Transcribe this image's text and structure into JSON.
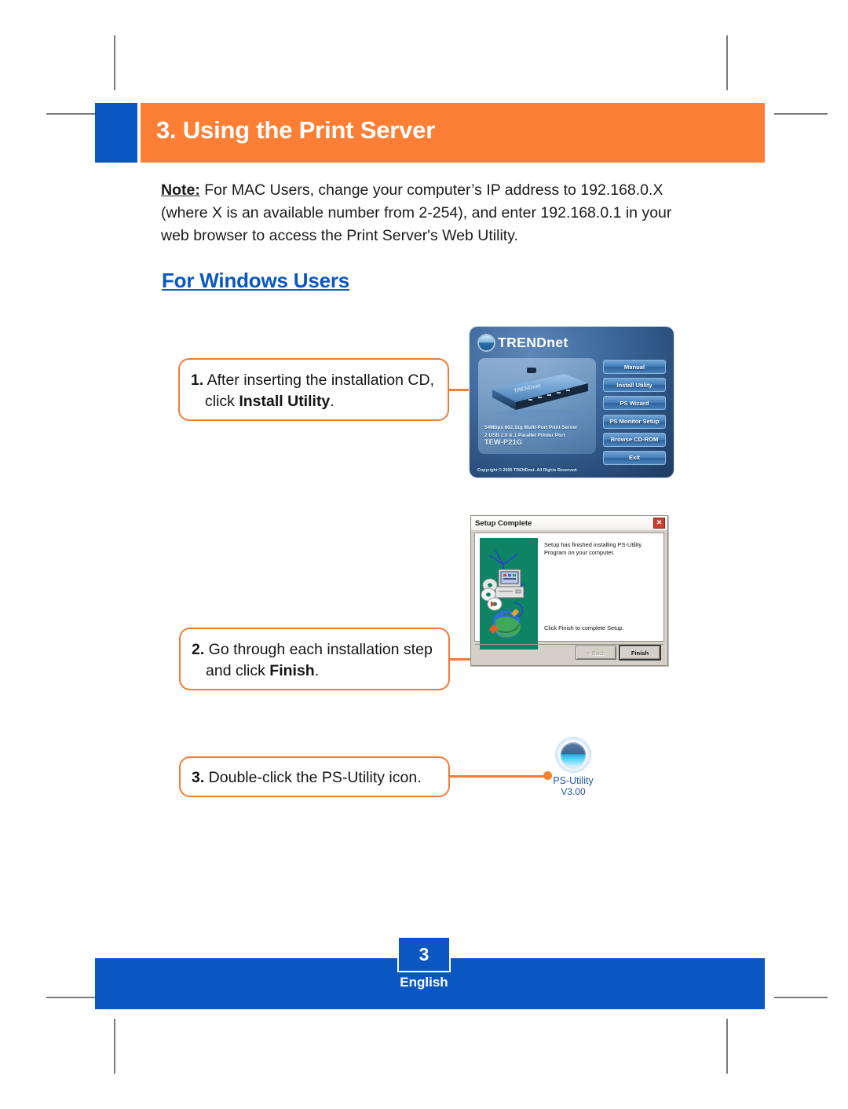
{
  "header": {
    "title": "3. Using the Print Server",
    "accent_blue": "#0a57c2",
    "accent_orange": "#fd7f36"
  },
  "note": {
    "label": "Note:",
    "line1": " For MAC Users, change your computer’s IP address to 192.168.0.X",
    "line2": "(where X is an available number from 2-254), and enter 192.168.0.1 in your",
    "line3": "web browser to access the Print Server's Web Utility."
  },
  "section": {
    "windows_heading": "For Windows Users"
  },
  "steps": [
    {
      "number": "1.",
      "line1": " After inserting the installation CD,",
      "line2_prefix": "click ",
      "line2_bold": "Install Utility",
      "line2_suffix": "."
    },
    {
      "number": "2.",
      "line1": " Go through each installation step",
      "line2_prefix": "and click ",
      "line2_bold": "Finish",
      "line2_suffix": "."
    },
    {
      "number": "3.",
      "line1": " Double-click the PS-Utility icon."
    }
  ],
  "autorun": {
    "brand": "TRENDnet",
    "device_line1": "54Mbps 802.11g Multi-Port Print Server",
    "device_line2": "2 USB 2.0 & 1 Parallel Printer Port",
    "device_model": "TEW-P21G",
    "copyright": "Copyright © 2006 TRENDnet. All Rights Reserved.",
    "buttons": [
      "Manual",
      "Install Utility",
      "PS Wizard",
      "PS Monitor Setup",
      "Browse CD-ROM",
      "Exit"
    ]
  },
  "setup_dialog": {
    "title": "Setup Complete",
    "close_glyph": "✕",
    "message": "Setup has finished installing PS-Utility Program on your computer.",
    "instruction": "Click Finish to complete Setup.",
    "back_button": "< Back",
    "finish_button": "Finish"
  },
  "psutility": {
    "label": "PS-Utility",
    "version": "V3.00"
  },
  "footer": {
    "page_number": "3",
    "language": "English"
  }
}
